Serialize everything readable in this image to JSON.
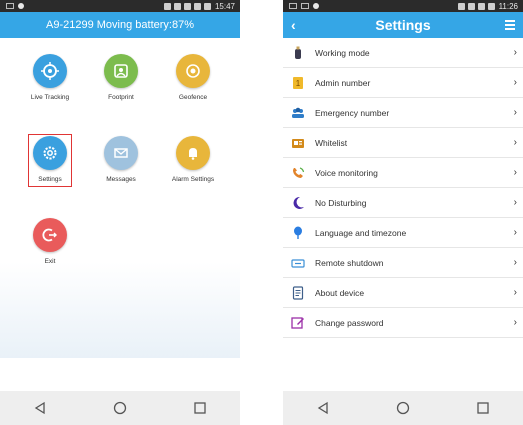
{
  "left": {
    "status_time": "15:47",
    "header_title": "A9-21299 Moving battery:87%",
    "tiles": [
      {
        "label": "Live Tracking",
        "color": "#3aa0df",
        "icon": "crosshair-icon"
      },
      {
        "label": "Footprint",
        "color": "#7cbc4d",
        "icon": "footprint-icon"
      },
      {
        "label": "Geofence",
        "color": "#e8b63b",
        "icon": "geofence-icon"
      },
      {
        "label": "Settings",
        "color": "#3aa0df",
        "icon": "gear-icon"
      },
      {
        "label": "Messages",
        "color": "#9fc2de",
        "icon": "envelope-icon"
      },
      {
        "label": "Alarm Settings",
        "color": "#e8b63b",
        "icon": "bell-icon"
      },
      {
        "label": "Exit",
        "color": "#e95b5b",
        "icon": "power-icon"
      }
    ]
  },
  "right": {
    "status_time": "11:26",
    "header_title": "Settings",
    "items": [
      {
        "label": "Working mode",
        "icon": "bottle-icon"
      },
      {
        "label": "Admin number",
        "icon": "admin-card-icon"
      },
      {
        "label": "Emergency number",
        "icon": "people-icon"
      },
      {
        "label": "Whitelist",
        "icon": "whitelist-icon"
      },
      {
        "label": "Voice monitoring",
        "icon": "phone-icon"
      },
      {
        "label": "No Disturbing",
        "icon": "moon-icon"
      },
      {
        "label": "Language and timezone",
        "icon": "globe-icon"
      },
      {
        "label": "Remote shutdown",
        "icon": "shutdown-icon"
      },
      {
        "label": "About device",
        "icon": "document-icon"
      },
      {
        "label": "Change password",
        "icon": "edit-icon"
      }
    ]
  },
  "colors": {
    "header_blue": "#35a6e6",
    "highlight_red": "#e03535"
  }
}
